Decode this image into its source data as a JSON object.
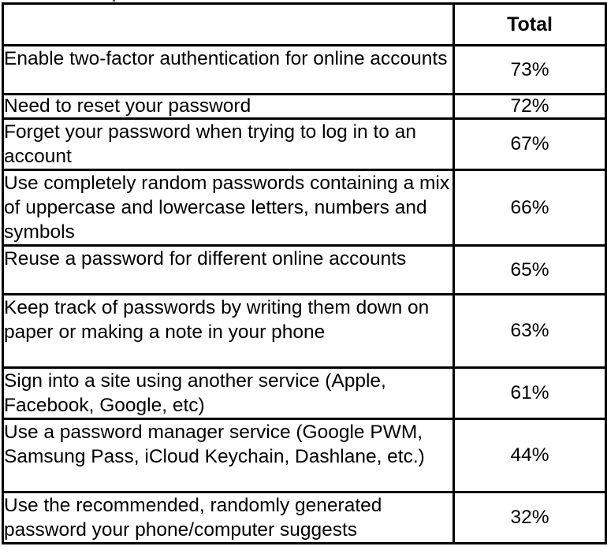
{
  "table": {
    "header": {
      "item_label": "",
      "total_label": "Total"
    },
    "rows": [
      {
        "item": "Enable two-factor authentication for online accounts",
        "total": "73%"
      },
      {
        "item": "Need to reset your password",
        "total": "72%"
      },
      {
        "item": "Forget your password when trying to log in to an account",
        "total": "67%"
      },
      {
        "item": "Use completely random passwords containing a mix of uppercase and lowercase letters, numbers and symbols",
        "total": "66%"
      },
      {
        "item": "Reuse a password for different online accounts",
        "total": "65%"
      },
      {
        "item": "Keep track of passwords by writing them down on paper or making a note in your phone",
        "total": "63%"
      },
      {
        "item": "Sign into a site using another service (Apple, Facebook, Google, etc)",
        "total": "61%"
      },
      {
        "item": "Use a password manager service (Google PWM, Samsung Pass, iCloud Keychain, Dashlane, etc.)",
        "total": "44%"
      },
      {
        "item": "Use the recommended, randomly generated password your phone/computer suggests",
        "total": "32%"
      }
    ]
  }
}
